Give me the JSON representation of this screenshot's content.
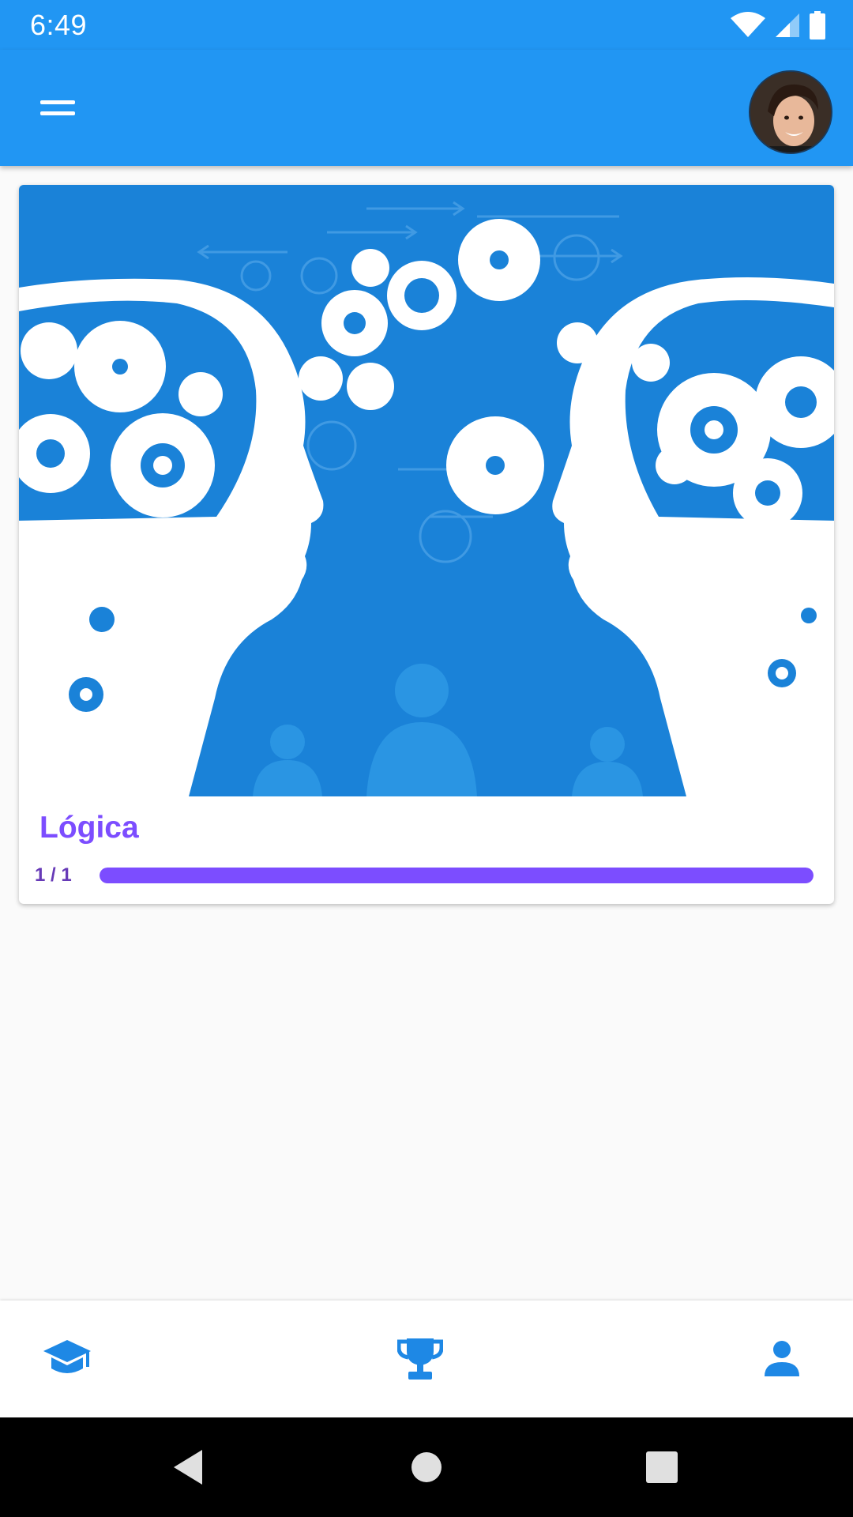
{
  "status_bar": {
    "time": "6:49",
    "icons": [
      "wifi-icon",
      "signal-icon",
      "battery-icon"
    ]
  },
  "app_bar": {
    "menu_icon": "hamburger-menu-icon",
    "avatar": "profile-avatar"
  },
  "course": {
    "title": "Lógica",
    "progress_text": "1 / 1",
    "progress": 1.0,
    "image": "heads-with-gears-illustration"
  },
  "bottom_nav": {
    "items": [
      {
        "icon": "graduation-cap-icon",
        "active": true
      },
      {
        "icon": "trophy-icon",
        "active": false
      },
      {
        "icon": "person-icon",
        "active": false
      }
    ]
  },
  "system_nav": {
    "buttons": [
      "back-icon",
      "home-icon",
      "recents-icon"
    ]
  },
  "colors": {
    "primary": "#2196f3",
    "accent": "#7c4dff",
    "progress_text": "#673ab7",
    "background": "#fafafa"
  }
}
